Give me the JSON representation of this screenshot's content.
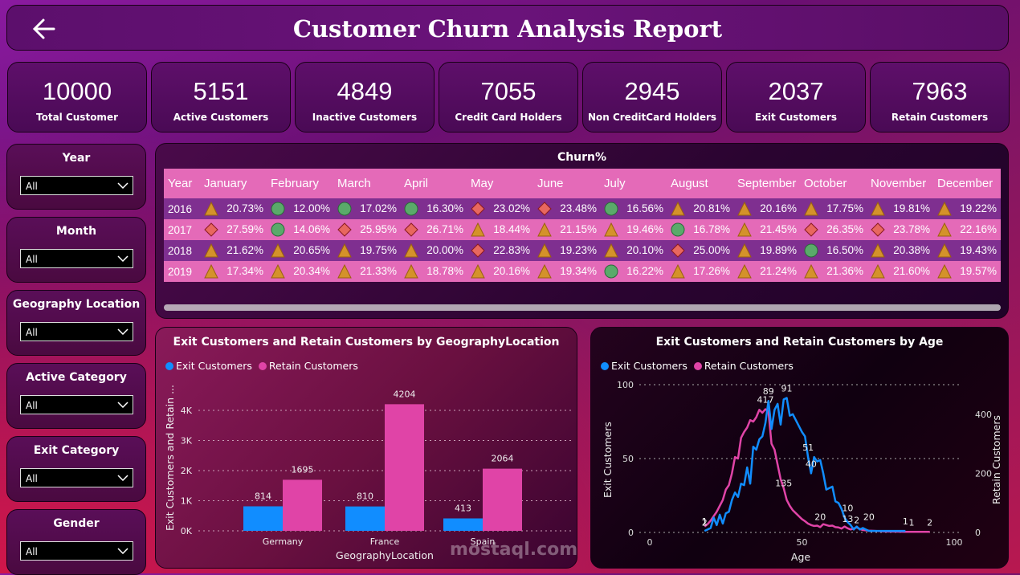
{
  "header": {
    "title": "Customer Churn Analysis Report",
    "back_icon": "arrow-left-icon"
  },
  "kpis": [
    {
      "value": "10000",
      "label": "Total Customer"
    },
    {
      "value": "5151",
      "label": "Active Customers"
    },
    {
      "value": "4849",
      "label": "Inactive Customers"
    },
    {
      "value": "7055",
      "label": "Credit Card Holders"
    },
    {
      "value": "2945",
      "label": "Non CreditCard Holders"
    },
    {
      "value": "2037",
      "label": "Exit Customers"
    },
    {
      "value": "7963",
      "label": "Retain Customers"
    }
  ],
  "slicers": [
    {
      "title": "Year",
      "value": "All"
    },
    {
      "title": "Month",
      "value": "All"
    },
    {
      "title": "Geography Location",
      "value": "All"
    },
    {
      "title": "Active Category",
      "value": "All"
    },
    {
      "title": "Exit Category",
      "value": "All"
    },
    {
      "title": "Gender",
      "value": "All"
    }
  ],
  "churn_table": {
    "title": "Churn%",
    "columns": [
      "Year",
      "January",
      "February",
      "March",
      "April",
      "May",
      "June",
      "July",
      "August",
      "September",
      "October",
      "November",
      "December"
    ],
    "icon_colors": {
      "triangle": "#d4922a",
      "circle": "#5aaa6a",
      "diamond": "#e8675f"
    },
    "rows": [
      {
        "year": "2016",
        "values": [
          "20.73%",
          "12.00%",
          "17.02%",
          "16.30%",
          "23.02%",
          "23.48%",
          "16.56%",
          "20.81%",
          "20.16%",
          "17.75%",
          "19.81%",
          "19.22%"
        ],
        "icons": [
          "triangle",
          "circle",
          "circle",
          "circle",
          "diamond",
          "diamond",
          "circle",
          "triangle",
          "triangle",
          "triangle",
          "triangle",
          "triangle"
        ]
      },
      {
        "year": "2017",
        "values": [
          "27.59%",
          "14.06%",
          "25.95%",
          "26.71%",
          "18.44%",
          "21.15%",
          "19.46%",
          "16.78%",
          "21.45%",
          "26.35%",
          "23.78%",
          "22.16%"
        ],
        "icons": [
          "diamond",
          "circle",
          "diamond",
          "diamond",
          "triangle",
          "triangle",
          "triangle",
          "circle",
          "triangle",
          "diamond",
          "diamond",
          "triangle"
        ]
      },
      {
        "year": "2018",
        "values": [
          "21.62%",
          "20.65%",
          "19.75%",
          "20.00%",
          "22.83%",
          "19.23%",
          "20.10%",
          "25.00%",
          "19.89%",
          "16.50%",
          "20.38%",
          "19.43%"
        ],
        "icons": [
          "triangle",
          "triangle",
          "triangle",
          "triangle",
          "diamond",
          "triangle",
          "triangle",
          "diamond",
          "triangle",
          "circle",
          "triangle",
          "triangle"
        ]
      },
      {
        "year": "2019",
        "values": [
          "17.34%",
          "20.34%",
          "21.33%",
          "18.78%",
          "20.16%",
          "19.34%",
          "16.22%",
          "17.26%",
          "21.24%",
          "21.36%",
          "21.60%",
          "19.57%"
        ],
        "icons": [
          "triangle",
          "triangle",
          "triangle",
          "triangle",
          "triangle",
          "triangle",
          "circle",
          "triangle",
          "triangle",
          "triangle",
          "triangle",
          "triangle"
        ]
      }
    ]
  },
  "chart_data": [
    {
      "type": "bar",
      "title": "Exit Customers and Retain Customers by GeographyLocation",
      "xlabel": "GeographyLocation",
      "ylabel": "Exit Customers and Retain ...",
      "categories": [
        "Germany",
        "France",
        "Spain"
      ],
      "series": [
        {
          "name": "Exit Customers",
          "color": "#118dff",
          "values": [
            814,
            810,
            413
          ]
        },
        {
          "name": "Retain Customers",
          "color": "#e044a7",
          "values": [
            1695,
            4204,
            2064
          ]
        }
      ],
      "ylim": [
        0,
        4400
      ],
      "yticks": [
        "0K",
        "1K",
        "2K",
        "3K",
        "4K"
      ],
      "legend": "top-left",
      "grid": true
    },
    {
      "type": "line",
      "title": "Exit Customers and Retain Customers by Age",
      "xlabel": "Age",
      "ylabel": "Exit Customers",
      "ylabel_right": "Retain Customers",
      "xlim": [
        0,
        100
      ],
      "xticks": [
        "0",
        "50",
        "100"
      ],
      "ylim": [
        0,
        100
      ],
      "yticks": [
        "0",
        "50",
        "100"
      ],
      "ylim_right": [
        0,
        500
      ],
      "yticks_right": [
        "0",
        "200",
        "400"
      ],
      "legend": "top-left",
      "grid": true,
      "series": [
        {
          "name": "Exit Customers",
          "color": "#118dff",
          "axis": "left",
          "x": [
            18,
            19,
            20,
            21,
            22,
            23,
            24,
            25,
            26,
            27,
            28,
            29,
            30,
            31,
            32,
            33,
            34,
            35,
            36,
            37,
            38,
            39,
            40,
            41,
            42,
            43,
            44,
            45,
            46,
            47,
            48,
            49,
            50,
            51,
            52,
            53,
            54,
            55,
            56,
            57,
            58,
            59,
            60,
            61,
            62,
            63,
            64,
            65,
            66,
            67,
            68,
            69,
            70,
            71,
            72,
            74,
            76,
            78,
            80,
            82,
            84
          ],
          "y": [
            1,
            2,
            3,
            10,
            5,
            12,
            6,
            13,
            14,
            22,
            27,
            24,
            33,
            32,
            44,
            33,
            58,
            56,
            63,
            65,
            74,
            89,
            70,
            83,
            87,
            73,
            90,
            91,
            79,
            80,
            76,
            72,
            68,
            65,
            51,
            40,
            51,
            48,
            49,
            40,
            29,
            30,
            31,
            21,
            20,
            16,
            10,
            7,
            5,
            2,
            4,
            2,
            3,
            2,
            1,
            1,
            1,
            1,
            1,
            1,
            1
          ]
        },
        {
          "name": "Retain Customers",
          "color": "#e044a7",
          "axis": "right",
          "x": [
            18,
            19,
            20,
            21,
            22,
            23,
            24,
            25,
            26,
            27,
            28,
            29,
            30,
            31,
            32,
            33,
            34,
            35,
            36,
            37,
            38,
            39,
            40,
            41,
            42,
            43,
            44,
            45,
            46,
            47,
            48,
            49,
            50,
            51,
            52,
            53,
            54,
            55,
            56,
            57,
            58,
            59,
            60,
            61,
            62,
            63,
            64,
            65,
            66,
            67,
            68,
            69,
            70,
            72,
            74,
            76,
            78,
            80,
            84,
            88,
            92
          ],
          "y": [
            20,
            28,
            40,
            55,
            70,
            90,
            110,
            145,
            160,
            200,
            255,
            250,
            320,
            340,
            355,
            380,
            375,
            390,
            415,
            405,
            417,
            410,
            300,
            280,
            230,
            180,
            150,
            110,
            90,
            75,
            65,
            55,
            45,
            38,
            30,
            25,
            22,
            23,
            18,
            28,
            25,
            22,
            23,
            18,
            17,
            13,
            20,
            14,
            10,
            13,
            17,
            12,
            8,
            6,
            5,
            4,
            3,
            3,
            2,
            2,
            2
          ]
        }
      ],
      "data_labels": [
        {
          "x": 18,
          "y": 2,
          "axis": "right",
          "text": "2"
        },
        {
          "x": 18,
          "y": 1,
          "axis": "left",
          "text": "1"
        },
        {
          "x": 38,
          "y": 417,
          "axis": "right",
          "text": "417"
        },
        {
          "x": 39,
          "y": 89,
          "axis": "left",
          "text": "89"
        },
        {
          "x": 45,
          "y": 91,
          "axis": "left",
          "text": "91"
        },
        {
          "x": 52,
          "y": 51,
          "axis": "left",
          "text": "51"
        },
        {
          "x": 44,
          "y": 135,
          "axis": "right",
          "text": "135"
        },
        {
          "x": 53,
          "y": 40,
          "axis": "left",
          "text": "40"
        },
        {
          "x": 56,
          "y": 20,
          "axis": "right",
          "text": "20"
        },
        {
          "x": 65,
          "y": 10,
          "axis": "left",
          "text": "10"
        },
        {
          "x": 68,
          "y": 2,
          "axis": "left",
          "text": "2"
        },
        {
          "x": 65,
          "y": 13,
          "axis": "right",
          "text": "13"
        },
        {
          "x": 72,
          "y": 20,
          "axis": "right",
          "text": "20"
        },
        {
          "x": 84,
          "y": 1,
          "axis": "left",
          "text": "1"
        },
        {
          "x": 86,
          "y": 1,
          "axis": "right",
          "text": "1"
        },
        {
          "x": 92,
          "y": 2,
          "axis": "right",
          "text": "2"
        }
      ]
    }
  ],
  "watermark": "mostaql.com"
}
